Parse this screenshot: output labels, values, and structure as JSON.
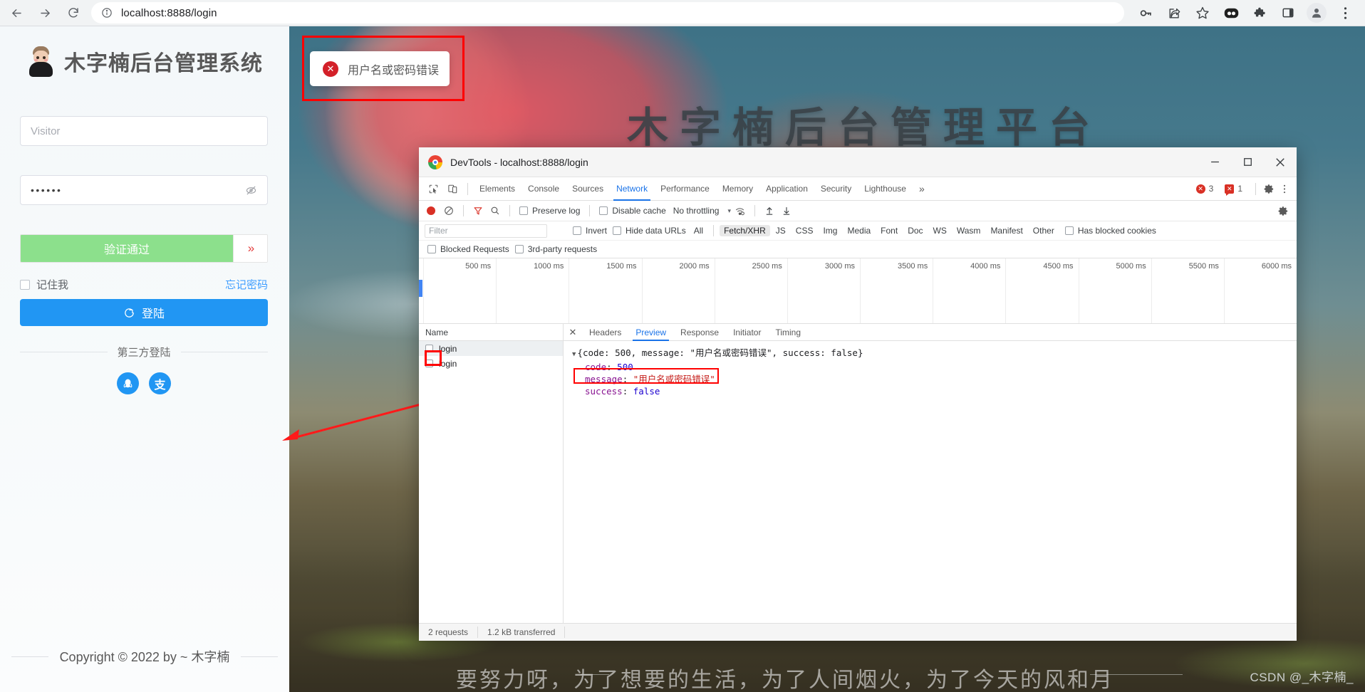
{
  "browser": {
    "back_icon": "back-arrow-icon",
    "forward_icon": "forward-arrow-icon",
    "reload_icon": "reload-icon",
    "site_info_icon": "site-info-icon",
    "url": "localhost:8888/login",
    "url_host": "localhost",
    "url_rest": ":8888/login",
    "toolbar_icons": [
      "key-icon",
      "share-icon",
      "bookmark-star-icon",
      "extension-dark-icon",
      "puzzle-extensions-icon",
      "side-panel-icon",
      "profile-avatar-icon",
      "chrome-menu-icon"
    ]
  },
  "login": {
    "brand_title": "木字楠后台管理系统",
    "username_placeholder": "Visitor",
    "password_value": "••••••",
    "password_toggle_icon": "eye-off-icon",
    "captcha_label": "验证通过",
    "captcha_handle": "»",
    "remember_label": "记住我",
    "forgot_label": "忘记密码",
    "login_button": "登陆",
    "login_icon": "login-arrow-icon",
    "third_party_label": "第三方登陆",
    "third_party": [
      {
        "name": "qq-login-icon",
        "glyph": "🐧"
      },
      {
        "name": "alipay-login-icon",
        "glyph": "支"
      }
    ],
    "copyright": "Copyright © 2022 by ~ 木字楠"
  },
  "page_bg": {
    "title": "木字楠后台管理平台",
    "slogan": "要努力呀，为了想要的生活，为了人间烟火，为了今天的风和月",
    "watermark": "CSDN @_木字楠_"
  },
  "toast": {
    "icon": "error-circle-icon",
    "icon_glyph": "✕",
    "message": "用户名或密码错误"
  },
  "devtools": {
    "window_title": "DevTools - localhost:8888/login",
    "window_controls": {
      "minimize": "−",
      "maximize": "▢",
      "close": "✕"
    },
    "tabs": [
      "Elements",
      "Console",
      "Sources",
      "Network",
      "Performance",
      "Memory",
      "Application",
      "Security",
      "Lighthouse"
    ],
    "active_tab": "Network",
    "more_tabs_glyph": "»",
    "error_count": "3",
    "warning_count": "1",
    "settings_icon": "gear-icon",
    "kebab_icon": "more-vertical-icon",
    "inspect_icon": "inspect-element-icon",
    "device_icon": "device-toolbar-icon",
    "network_toolbar": {
      "record_icon": "record-red-dot-icon",
      "clear_icon": "clear-no-entry-icon",
      "filter_icon": "funnel-filter-icon",
      "search_icon": "search-icon",
      "preserve_log": "Preserve log",
      "disable_cache": "Disable cache",
      "throttling": "No throttling",
      "throttle_caret": "▾",
      "wifi_icon": "network-conditions-icon",
      "import_icon": "import-har-icon",
      "export_icon": "export-har-icon",
      "settings_icon": "network-settings-gear-icon"
    },
    "filter_bar": {
      "filter_placeholder": "Filter",
      "invert": "Invert",
      "hide_data_urls": "Hide data URLs",
      "types": [
        "All",
        "Fetch/XHR",
        "JS",
        "CSS",
        "Img",
        "Media",
        "Font",
        "Doc",
        "WS",
        "Wasm",
        "Manifest",
        "Other"
      ],
      "active_type": "Fetch/XHR",
      "has_blocked_cookies": "Has blocked cookies",
      "blocked_requests": "Blocked Requests",
      "third_party_requests": "3rd-party requests"
    },
    "timeline_ticks": [
      "500 ms",
      "1000 ms",
      "1500 ms",
      "2000 ms",
      "2500 ms",
      "3000 ms",
      "3500 ms",
      "4000 ms",
      "4500 ms",
      "5000 ms",
      "5500 ms",
      "6000 ms"
    ],
    "request_table": {
      "header": "Name",
      "rows": [
        {
          "name": "login",
          "selected": true
        },
        {
          "name": "login",
          "selected": false
        }
      ]
    },
    "detail_tabs": [
      "Headers",
      "Preview",
      "Response",
      "Initiator",
      "Timing"
    ],
    "active_detail_tab": "Preview",
    "close_glyph": "✕",
    "preview": {
      "root_triangle": "▼",
      "summary_open": "{",
      "summary": "code: 500, message: \"用户名或密码错误\", success: false",
      "summary_close": "}",
      "rows": [
        {
          "key": "code",
          "value": "500",
          "type": "num"
        },
        {
          "key": "message",
          "value": "\"用户名或密码错误\"",
          "type": "str"
        },
        {
          "key": "success",
          "value": "false",
          "type": "bool"
        }
      ]
    },
    "status_bar": {
      "requests": "2 requests",
      "transferred": "1.2 kB transferred"
    }
  }
}
